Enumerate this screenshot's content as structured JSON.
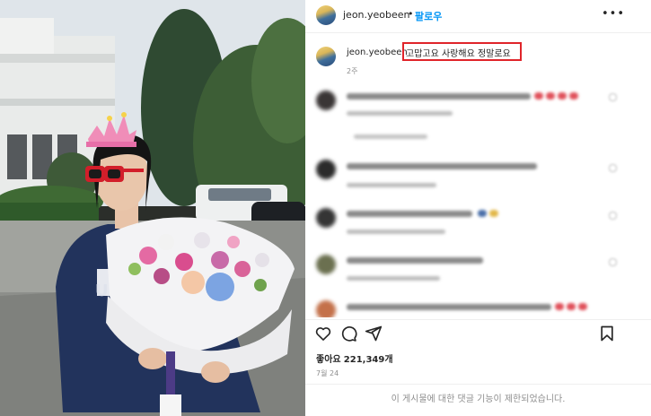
{
  "post": {
    "username": "jeon.yeobeen",
    "follow_label": "팔로우",
    "more_label": "•••",
    "dot": "•"
  },
  "caption": {
    "username": "jeon.yeobeen",
    "text": "고맙고요 사랑해요 정말로요",
    "time": "2주"
  },
  "comments": [
    {
      "username": "comment-user-1",
      "blurred": true
    },
    {
      "username": "comment-user-2",
      "blurred": true
    },
    {
      "username": "comment-user-3",
      "blurred": true
    },
    {
      "username": "comment-user-4",
      "blurred": true
    },
    {
      "username": "comment-user-5",
      "blurred": true
    }
  ],
  "actions": {
    "like_icon": "heart-icon",
    "comment_icon": "comment-icon",
    "share_icon": "share-icon",
    "save_icon": "bookmark-icon"
  },
  "likes": {
    "label": "좋아요",
    "count": "221,349개"
  },
  "date": "7월 24",
  "restricted_notice": "이 게시물에 대한 댓글 기능이 제한되었습니다.",
  "colors": {
    "accent": "#0095f6",
    "highlight": "#e0242a",
    "text": "#262626",
    "muted": "#8e8e8e"
  }
}
